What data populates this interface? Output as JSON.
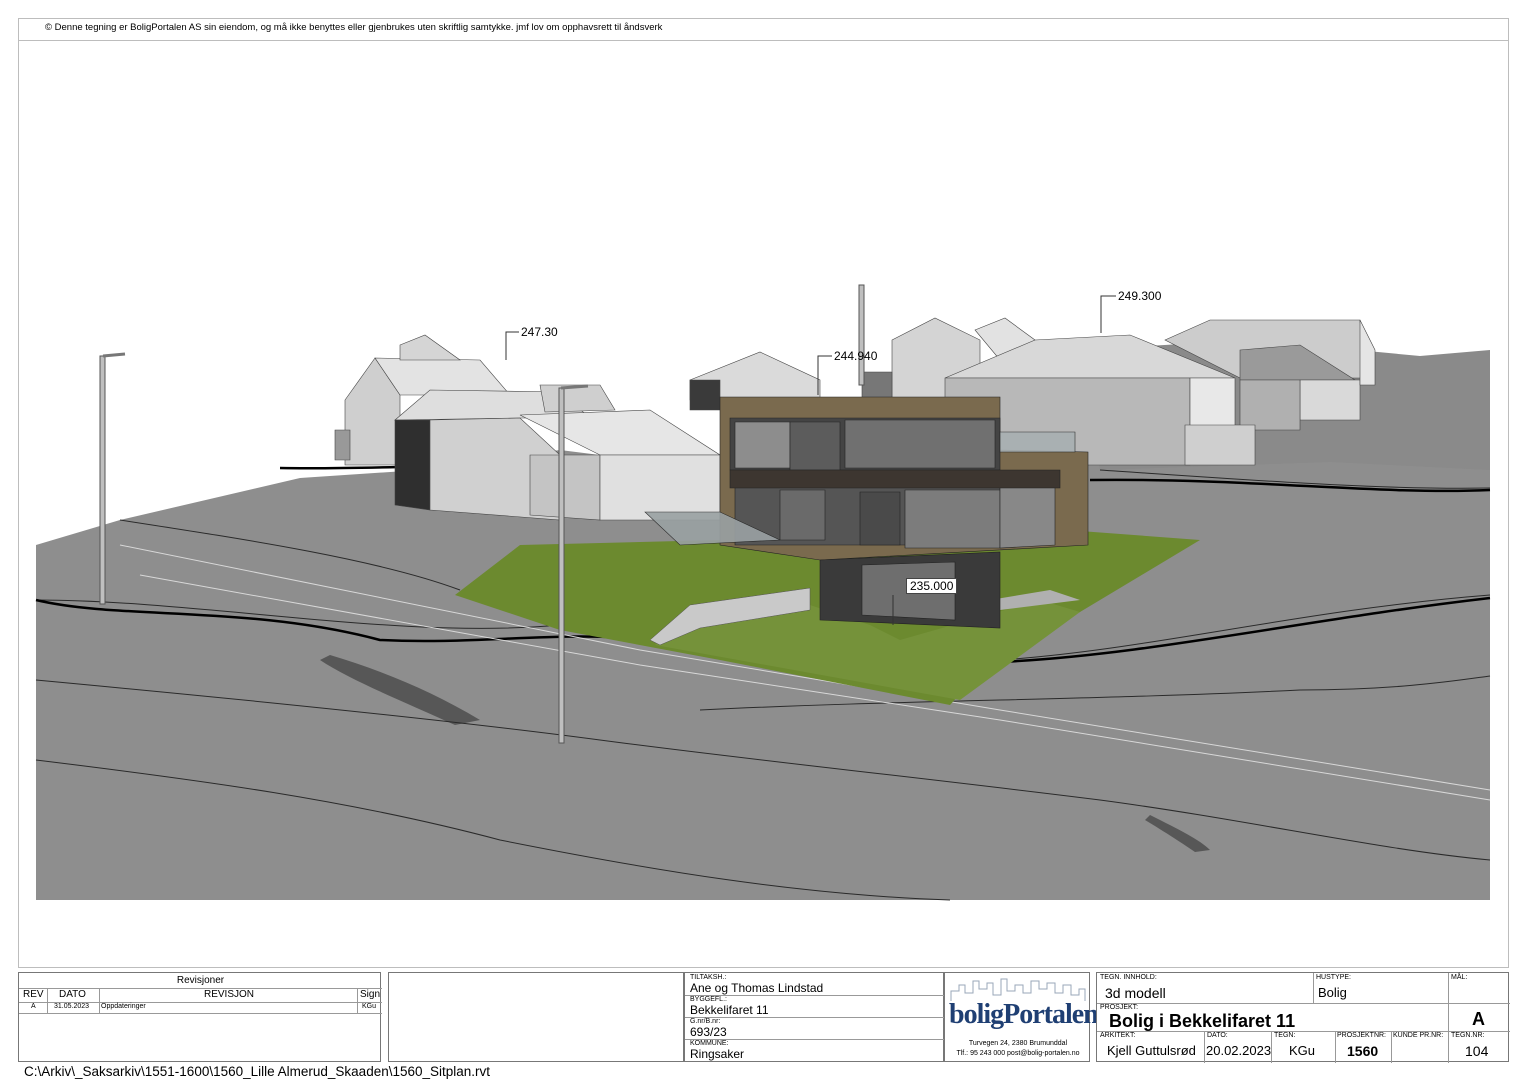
{
  "copyright": "© Denne tegning er BoligPortalen AS sin eiendom, og må ikke benyttes eller gjenbrukes uten skriftlig samtykke. jmf lov om opphavsrett til åndsverk",
  "elevations": {
    "left_house": "247.30",
    "center_house": "244.940",
    "right_house": "249.300",
    "ground_floor": "235.000"
  },
  "revisions": {
    "title": "Revisjoner",
    "headers": [
      "REV",
      "DATO",
      "REVISJON",
      "Sign"
    ],
    "rows": [
      {
        "rev": "A",
        "date": "31.05.2023",
        "text": "Oppdateringer",
        "sign": "KGu"
      }
    ]
  },
  "info": {
    "tiltakshaver_label": "TILTAKSH.:",
    "tiltakshaver": "Ane og Thomas Lindstad",
    "byggefelt_label": "BYGGEFL.:",
    "byggefelt": "Bekkelifaret 11",
    "gnr_label": "G.nr/B.nr:",
    "gnr": "693/23",
    "kommune_label": "KOMMUNE:",
    "kommune": "Ringsaker"
  },
  "logo": {
    "part1": "bolig",
    "part2": "Portalenas",
    "address": "Turvegen 24, 2380 Brumunddal",
    "contact": "Tlf.: 95 243 000 post@bolig-portalen.no"
  },
  "project": {
    "tegn_innhold_label": "TEGN. INNHOLD:",
    "tegn_innhold": "3d modell",
    "hustype_label": "HUSTYPE:",
    "hustype": "Bolig",
    "maal_label": "MÅL:",
    "prosjekt_label": "PROSJEKT:",
    "prosjekt": "Bolig i Bekkelifaret 11",
    "revision_letter": "A",
    "arkitekt_label": "ARKITEKT:",
    "arkitekt": "Kjell Guttulsrød",
    "dato_label": "DATO:",
    "dato": "20.02.2023",
    "tegn_label": "TEGN:",
    "tegn": "KGu",
    "prosjektnr_label": "PROSJEKTNR:",
    "prosjektnr": "1560",
    "kunde_label": "KUNDE PR.NR:",
    "tegnnr_label": "TEGN.NR:",
    "tegnnr": "104"
  },
  "file_path": "C:\\Arkiv\\_Saksarkiv\\1551-1600\\1560_Lille Almerud_Skaaden\\1560_Sitplan.rvt",
  "colors": {
    "terrain": "#8f8f8f",
    "lawn": "#6f8a30",
    "cladding": "#7a6a4e",
    "roof_light": "#d9d9d9",
    "roof_dark": "#3a3a3a"
  }
}
